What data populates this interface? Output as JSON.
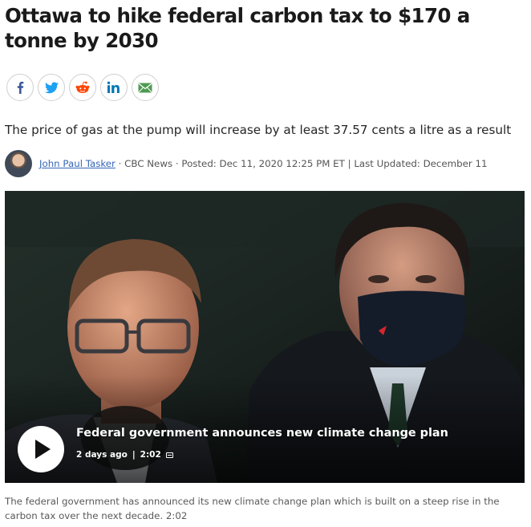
{
  "article": {
    "headline": "Ottawa to hike federal carbon tax to $170 a tonne by 2030",
    "dek": "The price of gas at the pump will increase by at least 37.57 cents a litre as a result"
  },
  "share": {
    "buttons": [
      {
        "name": "facebook-share-button",
        "icon": "facebook-icon",
        "color": "#3b5998"
      },
      {
        "name": "twitter-share-button",
        "icon": "twitter-icon",
        "color": "#1da1f2"
      },
      {
        "name": "reddit-share-button",
        "icon": "reddit-icon",
        "color": "#ff4500"
      },
      {
        "name": "linkedin-share-button",
        "icon": "linkedin-icon",
        "color": "#0077b5"
      },
      {
        "name": "email-share-button",
        "icon": "email-icon",
        "color": "#4f9a52"
      }
    ]
  },
  "byline": {
    "author": "John Paul Tasker",
    "source_sep": " · ",
    "source": "CBC News",
    "posted_label": "Posted: Dec 11, 2020 12:25 PM ET",
    "divider": " | ",
    "updated_label": "Last Updated: December 11"
  },
  "video": {
    "title": "Federal government announces new climate change plan",
    "age": "2 days ago",
    "separator": "|",
    "duration": "2:02",
    "icons": {
      "play": "play-icon",
      "captions": "closed-captions-icon"
    }
  },
  "caption": {
    "text": "The federal government has announced its new climate change plan which is built on a steep rise in the carbon tax over the next decade. 2:02"
  }
}
